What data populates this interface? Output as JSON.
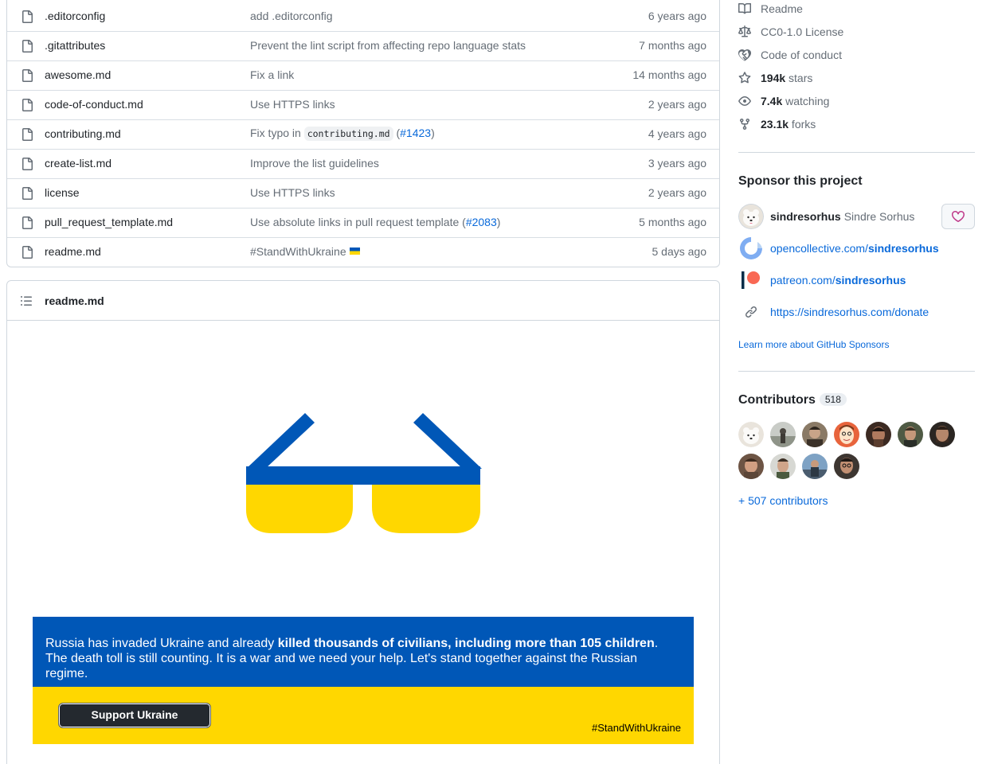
{
  "files": [
    {
      "name": ".editorconfig",
      "message": "add .editorconfig",
      "age": "6 years ago"
    },
    {
      "name": ".gitattributes",
      "message": "Prevent the lint script from affecting repo language stats",
      "age": "7 months ago"
    },
    {
      "name": "awesome.md",
      "message": "Fix a link",
      "age": "14 months ago"
    },
    {
      "name": "code-of-conduct.md",
      "message": "Use HTTPS links",
      "age": "2 years ago"
    },
    {
      "name": "contributing.md",
      "message_pre": "Fix typo in ",
      "message_code": "contributing.md",
      "message_open": " (",
      "message_link": "#1423",
      "message_close": ")",
      "age": "4 years ago"
    },
    {
      "name": "create-list.md",
      "message": "Improve the list guidelines",
      "age": "3 years ago"
    },
    {
      "name": "license",
      "message": "Use HTTPS links",
      "age": "2 years ago"
    },
    {
      "name": "pull_request_template.md",
      "message_pre": "Use absolute links in pull request template (",
      "message_link": "#2083",
      "message_close": ")",
      "age": "5 months ago"
    },
    {
      "name": "readme.md",
      "message": "#StandWithUkraine",
      "age": "5 days ago"
    }
  ],
  "readme": {
    "title": "readme.md",
    "banner_text_1": "Russia has invaded Ukraine and already ",
    "banner_bold": "killed thousands of civilians, including more than 105 children",
    "banner_text_2": ".",
    "banner_text_3": "The death toll is still counting. It is a war and we need your help. Let's stand together against the Russian regime.",
    "support_button": "Support Ukraine",
    "stand_tag": "#StandWithUkraine",
    "colors": {
      "ukraine_blue": "#0057b7",
      "ukraine_yellow": "#ffd700"
    }
  },
  "about": {
    "readme": "Readme",
    "license": "CC0-1.0 License",
    "conduct": "Code of conduct",
    "stars_count": "194k",
    "stars_label": " stars",
    "watching_count": "7.4k",
    "watching_label": " watching",
    "forks_count": "23.1k",
    "forks_label": " forks"
  },
  "sponsor": {
    "title": "Sponsor this project",
    "user_login": "sindresorhus",
    "user_name": "Sindre Sorhus",
    "opencollective_prefix": "opencollective.com/",
    "opencollective_user": "sindresorhus",
    "patreon_prefix": "patreon.com/",
    "patreon_user": "sindresorhus",
    "custom_link": "https://sindresorhus.com/donate",
    "learn_more": "Learn more about GitHub Sponsors"
  },
  "contributors": {
    "title": "Contributors",
    "count": "518",
    "more": "+ 507 contributors"
  }
}
